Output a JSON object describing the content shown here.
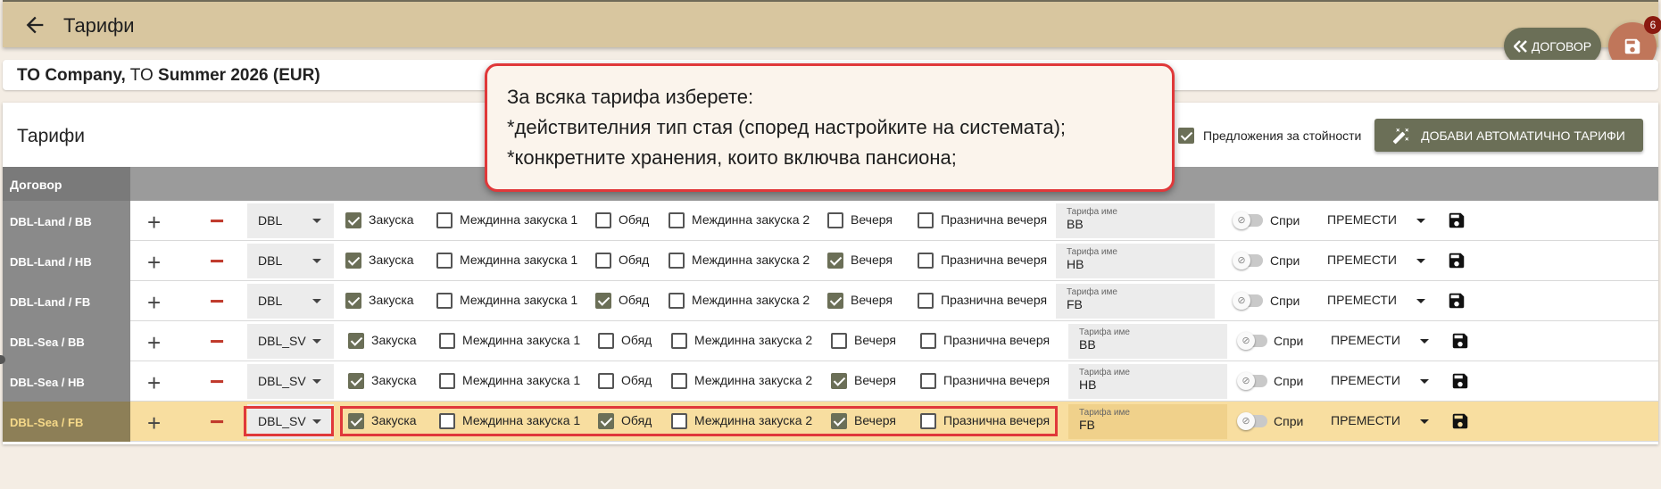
{
  "header": {
    "title": "Тарифи",
    "back_icon": "arrow-left-icon"
  },
  "fab": {
    "contract_label": "ДОГОВОР",
    "contract_icon": "double-chevron-left-icon",
    "save_icon": "floppy-disk-icon",
    "badge": "6"
  },
  "company": {
    "name": "TO Company,",
    "to": "TO",
    "season": "Summer 2026 (EUR)"
  },
  "card": {
    "title": "Тарифи",
    "offers_label": "Предложения за стойности",
    "auto_button": "ДОБАВИ АВТОМАТИЧНО ТАРИФИ",
    "column_header": "Договор"
  },
  "meals": [
    "Закуска",
    "Междинна закуска 1",
    "Обяд",
    "Междинна закуска 2",
    "Вечеря",
    "Празнична вечеря"
  ],
  "rate_name_label": "Тарифа име",
  "stop_label": "Спри",
  "move_label": "ПРЕМЕСТИ",
  "rows": [
    {
      "label": "DBL-Land / BB",
      "room": "DBL",
      "checks": [
        true,
        false,
        false,
        false,
        false,
        false
      ],
      "rate": "BB"
    },
    {
      "label": "DBL-Land / HB",
      "room": "DBL",
      "checks": [
        true,
        false,
        false,
        false,
        true,
        false
      ],
      "rate": "HB"
    },
    {
      "label": "DBL-Land / FB",
      "room": "DBL",
      "checks": [
        true,
        false,
        true,
        false,
        true,
        false
      ],
      "rate": "FB"
    },
    {
      "label": "DBL-Sea / BB",
      "room": "DBL_SV",
      "checks": [
        true,
        false,
        false,
        false,
        false,
        false
      ],
      "rate": "BB"
    },
    {
      "label": "DBL-Sea / HB",
      "room": "DBL_SV",
      "checks": [
        true,
        false,
        false,
        false,
        true,
        false
      ],
      "rate": "HB"
    },
    {
      "label": "DBL-Sea / FB",
      "room": "DBL_SV",
      "checks": [
        true,
        false,
        true,
        false,
        true,
        false
      ],
      "rate": "FB"
    }
  ],
  "tooltip": {
    "line1": "За всяка тарифа изберете:",
    "line2": "*действителния тип стая (според настройките на системата);",
    "line3": "*конкретните хранения, които включва пансиона;"
  },
  "colors": {
    "accent": "#6b6f57",
    "topbar": "#d8c69f",
    "highlight_row": "#f8dea0",
    "annotation_red": "#e0383a"
  }
}
